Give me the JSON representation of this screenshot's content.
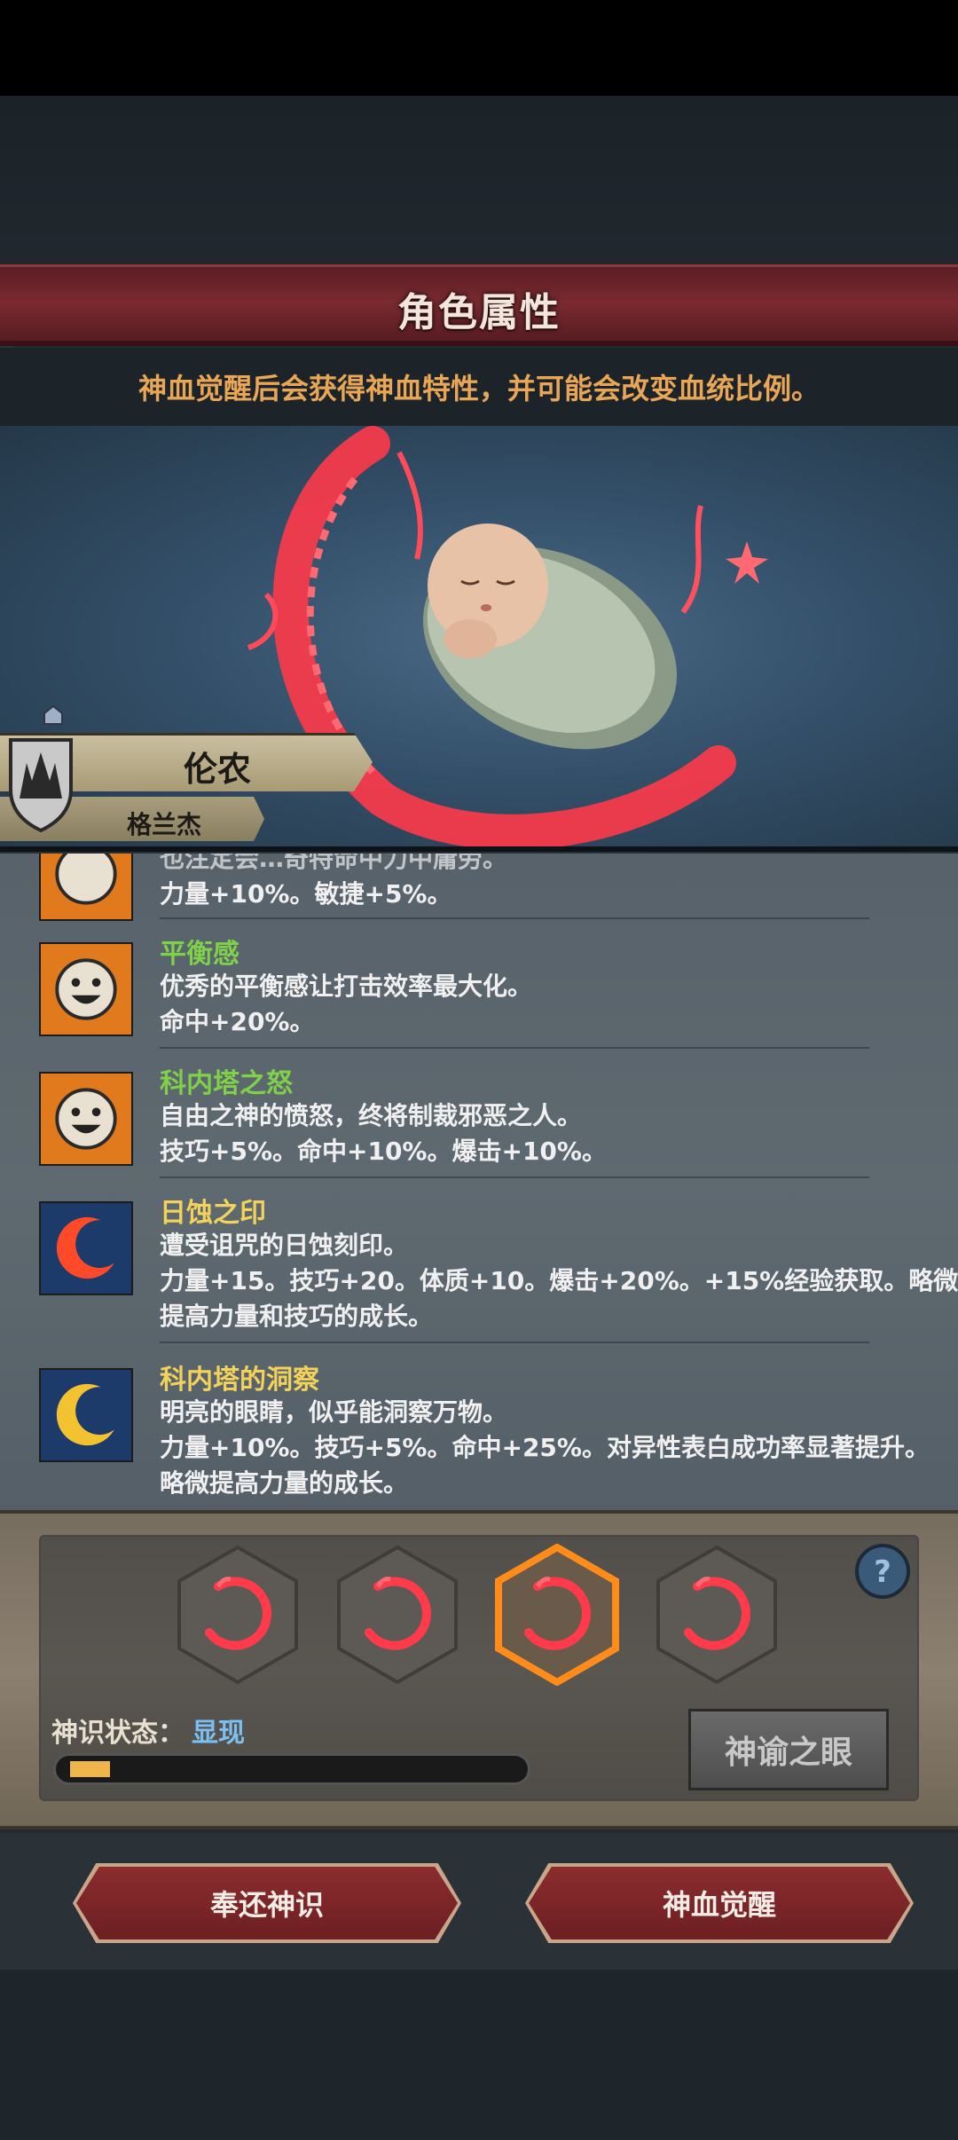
{
  "title": "角色属性",
  "hint": "神血觉醒后会获得神血特性，并可能会改变血统比例。",
  "character": {
    "name": "伦农",
    "family": "格兰杰"
  },
  "traits": [
    {
      "name": "",
      "color": "#ffffff",
      "icon": "sun-face-icon",
      "lines": [
        "也注定会…奇特命中力中庸劳。",
        "力量+10%。敏捷+5%。"
      ]
    },
    {
      "name": "平衡感",
      "color": "#7fd04a",
      "icon": "sun-face-icon",
      "lines": [
        "优秀的平衡感让打击效率最大化。",
        "命中+20%。"
      ]
    },
    {
      "name": "科内塔之怒",
      "color": "#7fd04a",
      "icon": "sun-face-icon",
      "lines": [
        "自由之神的愤怒，终将制裁邪恶之人。",
        "技巧+5%。命中+10%。爆击+10%。"
      ]
    },
    {
      "name": "日蚀之印",
      "color": "#f2d25a",
      "icon": "red-crescent-icon",
      "lines": [
        "遭受诅咒的日蚀刻印。",
        "力量+15。技巧+20。体质+10。爆击+20%。+15%经验获取。略微",
        "提高力量和技巧的成长。"
      ]
    },
    {
      "name": "科内塔的洞察",
      "color": "#f2d25a",
      "icon": "gold-crescent-icon",
      "lines": [
        "明亮的眼睛，似乎能洞察万物。",
        "力量+10%。技巧+5%。命中+25%。对异性表白成功率显著提升。",
        "略微提高力量的成长。"
      ]
    }
  ],
  "slots": [
    {
      "icon": "blood-swirl-icon",
      "selected": false
    },
    {
      "icon": "blood-swirl-icon",
      "selected": false
    },
    {
      "icon": "blood-swirl-icon",
      "selected": true
    },
    {
      "icon": "blood-swirl-icon",
      "selected": false
    }
  ],
  "status": {
    "label": "神识状态：",
    "value": "显现",
    "progress": 0.09
  },
  "buttons": {
    "oracle": "神谕之眼",
    "return": "奉还神识",
    "awaken": "神血觉醒"
  },
  "colors": {
    "banner": "#7a2a30",
    "hint": "#e8a656",
    "status_value": "#7bc0f2",
    "progress": "#f0b54a"
  }
}
